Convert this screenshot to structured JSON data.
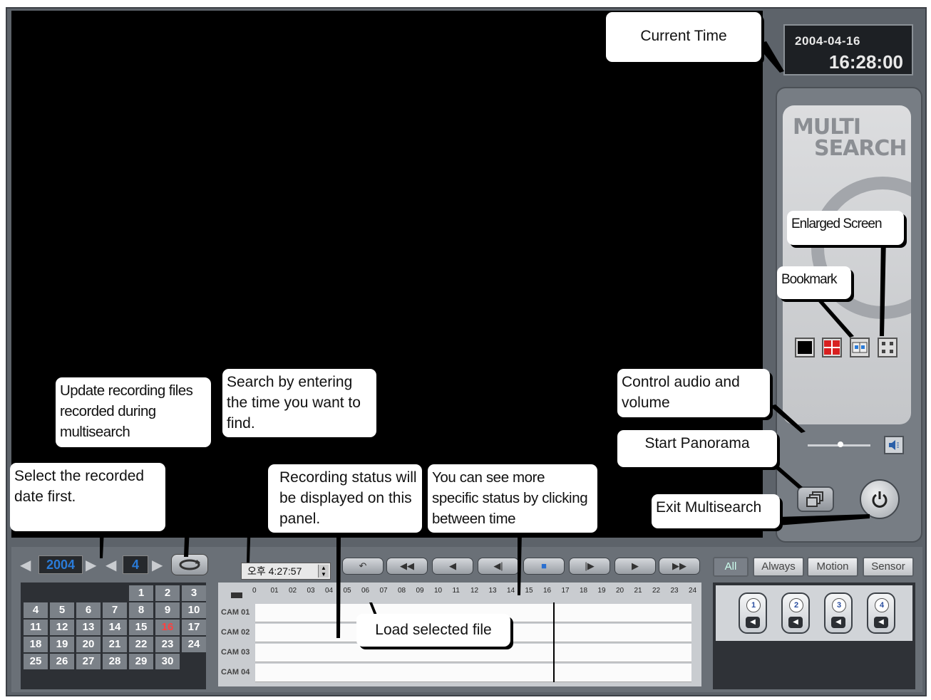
{
  "clock": {
    "date": "2004-04-16",
    "time": "16:28:00"
  },
  "logo": {
    "line1": "MULTI",
    "line2": "SEARCH"
  },
  "calendar": {
    "year": "2004",
    "month": "4",
    "days": [
      "1",
      "2",
      "3",
      "4",
      "5",
      "6",
      "7",
      "8",
      "9",
      "10",
      "11",
      "12",
      "13",
      "14",
      "15",
      "16",
      "17",
      "18",
      "19",
      "20",
      "21",
      "22",
      "23",
      "24",
      "25",
      "26",
      "27",
      "28",
      "29",
      "30"
    ],
    "recorded_day": "16"
  },
  "time_search": {
    "value": "오후 4:27:57"
  },
  "timeline": {
    "hours": [
      "0",
      "01",
      "02",
      "03",
      "04",
      "05",
      "06",
      "07",
      "08",
      "09",
      "10",
      "11",
      "12",
      "13",
      "14",
      "15",
      "16",
      "17",
      "18",
      "19",
      "20",
      "21",
      "22",
      "23",
      "24"
    ],
    "cameras": [
      "CAM 01",
      "CAM 02",
      "CAM 03",
      "CAM 04"
    ]
  },
  "filters": [
    "All",
    "Always",
    "Motion",
    "Sensor"
  ],
  "camera_buttons": [
    "1",
    "2",
    "3",
    "4"
  ],
  "callouts": {
    "current_time": "Current Time",
    "enlarged_screen": "Enlarged Screen",
    "bookmark": "Bookmark",
    "control_audio": "Control audio and volume",
    "start_panorama": "Start Panorama",
    "exit_multisearch": "Exit Multisearch",
    "update_recording": "Update recording files recorded during multisearch",
    "search_time": "Search by entering the time you want to find.",
    "select_date": "Select the recorded date first.",
    "recording_status": "Recording status will be displayed on this panel.",
    "specific_status": "You can see more specific status by clicking between time",
    "load_file": "Load selected file"
  },
  "colors": {
    "video_bg": "#000000",
    "accent_blue": "#2a7bd8",
    "frame": "#5d636a"
  }
}
